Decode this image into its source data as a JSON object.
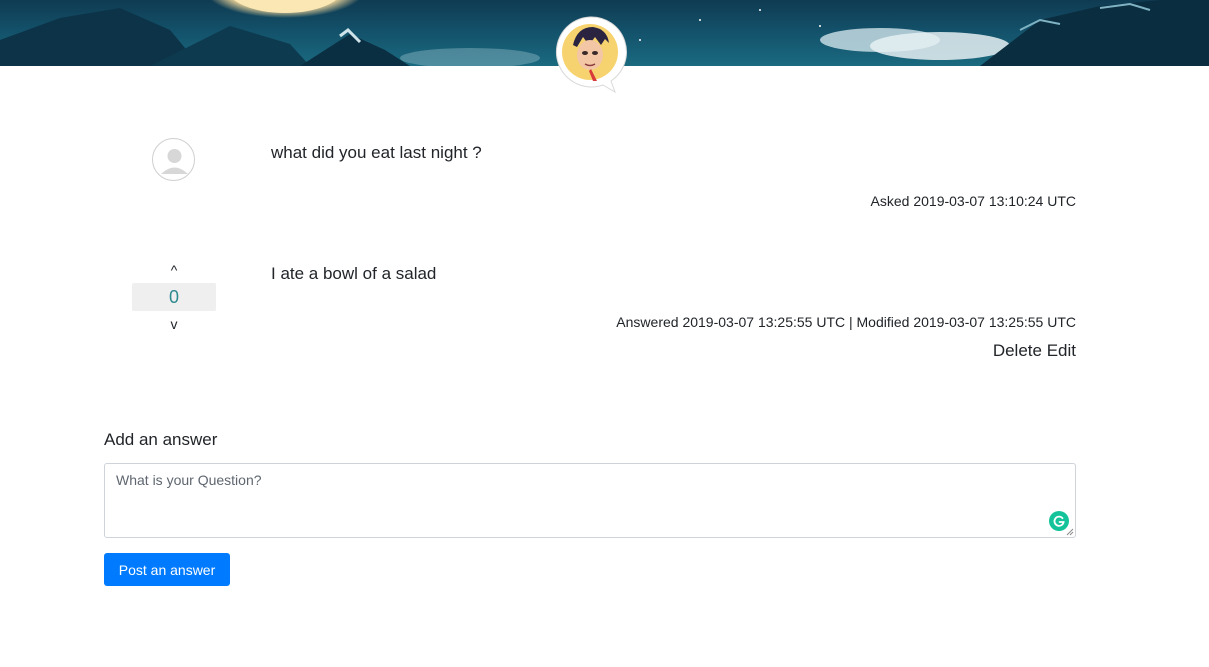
{
  "question": {
    "text": "what did you eat last night ?",
    "asked_meta": "Asked 2019-03-07 13:10:24 UTC"
  },
  "answer": {
    "text": "I ate a bowl of a salad",
    "vote_up": "^",
    "vote_count": "0",
    "vote_down": "v",
    "meta": "Answered 2019-03-07 13:25:55 UTC | Modified 2019-03-07 13:25:55 UTC",
    "delete_label": "Delete",
    "edit_label": "Edit"
  },
  "form": {
    "title": "Add an answer",
    "placeholder": "What is your Question?",
    "value": "",
    "submit_label": "Post an answer"
  },
  "icons": {
    "logo": "cartoon-avatar-logo",
    "user": "user-placeholder-icon",
    "grammarly": "grammarly-icon"
  },
  "colors": {
    "accent": "#007bff",
    "vote_count": "#2d8a8f",
    "grammarly": "#15c39a",
    "banner": "#135069"
  }
}
